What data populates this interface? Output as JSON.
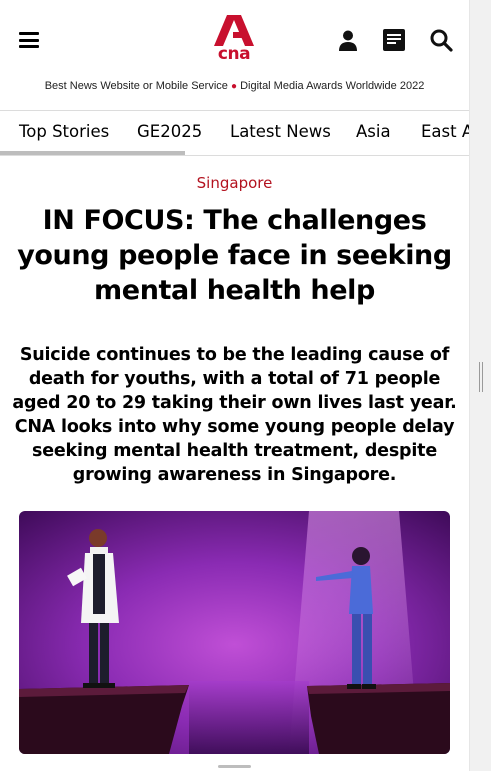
{
  "header": {
    "logo_text": "cna",
    "award_left": "Best News Website or Mobile Service",
    "award_dot": "●",
    "award_right": "Digital Media Awards Worldwide 2022",
    "brand_color": "#c8102e"
  },
  "icons": {
    "menu": "hamburger-menu-icon",
    "user": "user-icon",
    "news": "newsletter-icon",
    "search": "search-icon"
  },
  "nav": {
    "items": [
      {
        "label": "Top Stories"
      },
      {
        "label": "GE2025"
      },
      {
        "label": "Latest News"
      },
      {
        "label": "Asia"
      },
      {
        "label": "East A"
      }
    ]
  },
  "article": {
    "category": "Singapore",
    "category_color": "#b3121f",
    "headline": "IN FOCUS: The challenges young people face in seeking mental health help",
    "summary": "Suicide continues to be the leading cause of death for youths, with a total of 71 people aged 20 to 29 taking their own lives last year. CNA looks into why some young people delay seeking mental health treatment, despite growing awareness in Singapore."
  }
}
